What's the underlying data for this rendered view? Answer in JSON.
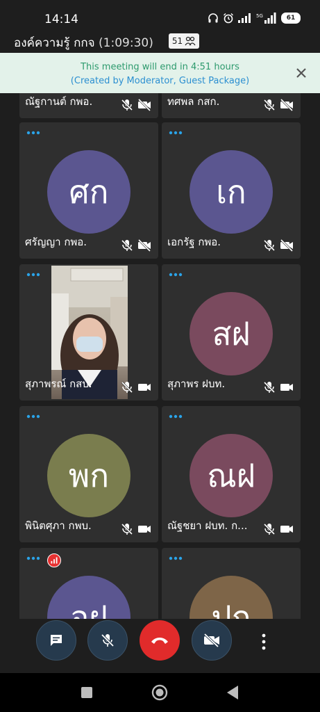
{
  "status": {
    "time": "14:14",
    "battery": "61",
    "network": "5G"
  },
  "meeting": {
    "name": "องค์ความรู้ กกจ",
    "duration": "(1:09:30)",
    "participants": "51"
  },
  "banner": {
    "line1": "This meeting will end in 4:51 hours",
    "line2": "(Created by Moderator, Guest Package)"
  },
  "tiles": [
    {
      "name": "ณัฐกานต์ กพอ.",
      "mic_muted": true,
      "cam_off": true
    },
    {
      "name": "ทศพล กสก.",
      "mic_muted": true,
      "cam_off": true
    },
    {
      "name": "ศรัญญา กพอ.",
      "initials": "ศก",
      "color": "#5b5690",
      "mic_muted": true,
      "cam_off": true
    },
    {
      "name": "เอกรัฐ กพอ.",
      "initials": "เก",
      "color": "#5b5690",
      "mic_muted": true,
      "cam_off": true
    },
    {
      "name": "สุภาพรณ์ กสบ.",
      "video": true,
      "mic_muted": true,
      "cam_off": false
    },
    {
      "name": "สุภาพร ฝบท.",
      "initials": "สฝ",
      "color": "#7a4a5e",
      "mic_muted": true,
      "cam_off": false
    },
    {
      "name": "พินิตศุภา กพบ.",
      "initials": "พก",
      "color": "#7a7d4e",
      "mic_muted": true,
      "cam_off": false
    },
    {
      "name": "ณัฐชยา ฝบท. ก...",
      "initials": "ณฝ",
      "color": "#7a4a5e",
      "mic_muted": true,
      "cam_off": false
    },
    {
      "initials": "อฝ",
      "color": "#5b5690"
    },
    {
      "initials": "ปก",
      "color": "#7e6548"
    }
  ],
  "colors": {
    "accent": "#2b8fd1",
    "tile_bg": "#2f2f2f",
    "end_call": "#e12b2b",
    "control_bg": "#263a4d"
  }
}
